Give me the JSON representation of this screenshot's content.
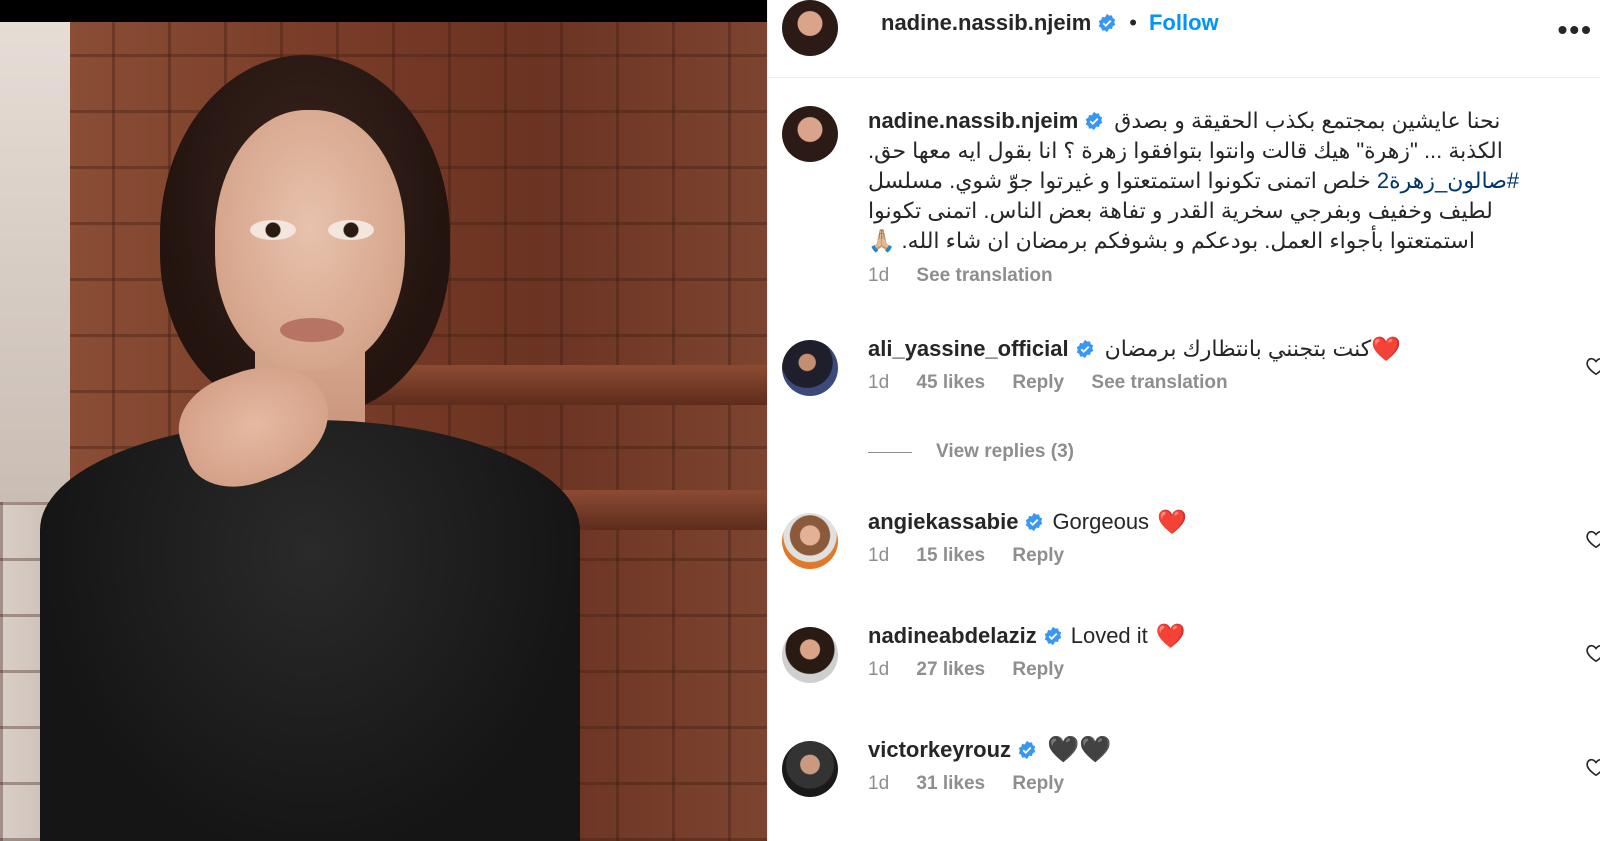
{
  "post": {
    "author": "nadine.nassib.njeim",
    "follow_label": "Follow",
    "separator": "•",
    "more": "•••"
  },
  "caption": {
    "author": "nadine.nassib.njeim",
    "line1": "نحنا عايشين بمجتمع بكذب الحقيقة و بصدق",
    "line2": "الكذبة ... \"زهرة\" هيك قالت وانتوا بتوافقوا زهرة ؟ انا بقول ايه معها حق.",
    "hashtag": "#صالون_زهرة2",
    "line3_rest": "خلص اتمنى تكونوا استمتعتوا و غيرتوا جوّ شوي. مسلسل",
    "line4": "لطيف وخفيف وبفرجي سخرية القدر و تفاهة بعض الناس. اتمنى تكونوا",
    "line5": "استمتعتوا بأجواء العمل. بودعكم و بشوفكم برمضان ان شاء الله.",
    "line5_emoji": "🙏🏼",
    "time": "1d",
    "see_translation": "See translation"
  },
  "comments": [
    {
      "username": "ali_yassine_official",
      "text": "كنت بتجنني بانتظارك برمضان",
      "emoji": "❤️",
      "time": "1d",
      "likes": "45 likes",
      "reply": "Reply",
      "see_translation": "See translation",
      "view_replies": "View replies (3)"
    },
    {
      "username": "angiekassabie",
      "text": "Gorgeous",
      "emoji": "❤️",
      "time": "1d",
      "likes": "15 likes",
      "reply": "Reply"
    },
    {
      "username": "nadineabdelaziz",
      "text": "Loved it",
      "emoji": "❤️",
      "time": "1d",
      "likes": "27 likes",
      "reply": "Reply"
    },
    {
      "username": "victorkeyrouz",
      "text": "",
      "emoji": "🖤🖤",
      "time": "1d",
      "likes": "31 likes",
      "reply": "Reply"
    }
  ],
  "colors": {
    "link_blue": "#0095f6",
    "verified_blue": "#3897f0",
    "muted": "#8e8e8e",
    "hashtag": "#00376b"
  },
  "icons": {
    "verified": "verified-badge-icon",
    "heart": "heart-outline-icon",
    "more": "more-options-icon"
  }
}
